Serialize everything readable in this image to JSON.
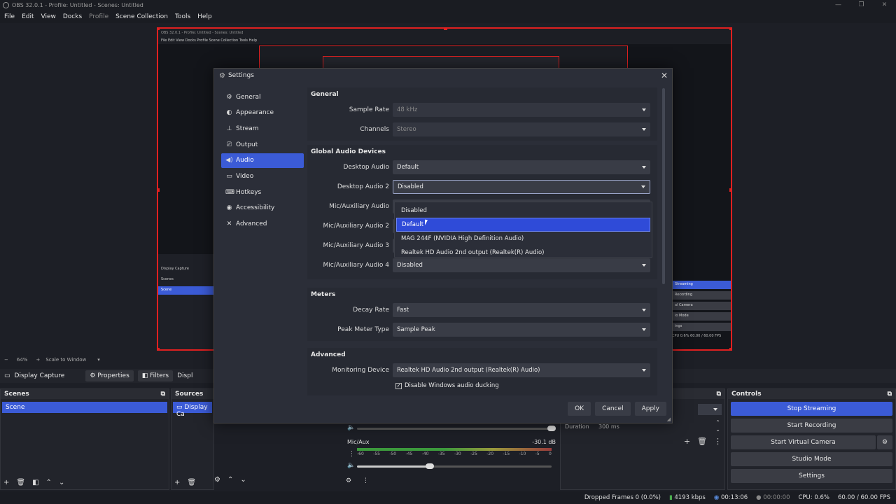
{
  "window": {
    "title": "OBS 32.0.1 - Profile: Untitled - Scenes: Untitled",
    "controls": [
      "—",
      "❐",
      "✕"
    ]
  },
  "menu": [
    "File",
    "Edit",
    "View",
    "Docks",
    "Profile",
    "Scene Collection",
    "Tools",
    "Help"
  ],
  "preview": {
    "mini_title": "OBS 32.0.1 - Profile: Untitled - Scenes: Untitled",
    "mini_menu": "File  Edit  View  Docks  Profile  Scene Collection  Tools  Help",
    "mini_capture": "Display Capture",
    "mini_scenes": "Scenes",
    "mini_scene": "Scene",
    "mini_buttons": [
      "Streaming",
      "Recording",
      "al Camera",
      "io Mode",
      "ings"
    ],
    "mini_stats": "CPU 0.6%   60.00 / 60.00 FPS"
  },
  "zoom": {
    "minus": "−",
    "level": "64%",
    "plus": "+",
    "label": "Scale to Window"
  },
  "source_toolbar": {
    "capture": "Display Capture",
    "properties": "Properties",
    "filters": "Filters",
    "display": "Displ"
  },
  "scenes": {
    "title": "Scenes",
    "selected": "Scene"
  },
  "sources": {
    "title": "Sources",
    "selected": "Display Ca"
  },
  "controls": {
    "title": "Controls",
    "buttons": [
      "Stop Streaming",
      "Start Recording",
      "Start Virtual Camera",
      "Studio Mode",
      "Settings"
    ]
  },
  "transition": {
    "duration_label": "Duration",
    "duration_value": "300 ms"
  },
  "mixer": {
    "name": "Mic/Aux",
    "db": "-30.1 dB",
    "ticks": [
      "-60",
      "-55",
      "-50",
      "-45",
      "-40",
      "-35",
      "-30",
      "-25",
      "-20",
      "-15",
      "-10",
      "-5",
      "0"
    ]
  },
  "status": {
    "dropped": "Dropped Frames 0 (0.0%)",
    "bitrate": "4193 kbps",
    "stream_time": "00:13:06",
    "rec_time": "00:00:00",
    "cpu": "CPU: 0.6%",
    "fps": "60.00 / 60.00 FPS"
  },
  "settings": {
    "title": "Settings",
    "nav": [
      "General",
      "Appearance",
      "Stream",
      "Output",
      "Audio",
      "Video",
      "Hotkeys",
      "Accessibility",
      "Advanced"
    ],
    "active_nav": "Audio",
    "general": {
      "title": "General",
      "sample_rate_label": "Sample Rate",
      "sample_rate": "48 kHz",
      "channels_label": "Channels",
      "channels": "Stereo"
    },
    "devices": {
      "title": "Global Audio Devices",
      "rows": [
        {
          "label": "Desktop Audio",
          "value": "Default"
        },
        {
          "label": "Desktop Audio 2",
          "value": "Disabled"
        },
        {
          "label": "Mic/Auxiliary Audio",
          "value": ""
        },
        {
          "label": "Mic/Auxiliary Audio 2",
          "value": ""
        },
        {
          "label": "Mic/Auxiliary Audio 3",
          "value": ""
        },
        {
          "label": "Mic/Auxiliary Audio 4",
          "value": "Disabled"
        }
      ],
      "popup": [
        "Disabled",
        "Default",
        "MAG 244F (NVIDIA High Definition Audio)",
        "Realtek HD Audio 2nd output (Realtek(R) Audio)"
      ],
      "popup_highlight": "Default"
    },
    "meters": {
      "title": "Meters",
      "decay_label": "Decay Rate",
      "decay": "Fast",
      "peak_label": "Peak Meter Type",
      "peak": "Sample Peak"
    },
    "advanced": {
      "title": "Advanced",
      "monitor_label": "Monitoring Device",
      "monitor": "Realtek HD Audio 2nd output (Realtek(R) Audio)",
      "ducking": "Disable Windows audio ducking"
    },
    "buttons": {
      "ok": "OK",
      "cancel": "Cancel",
      "apply": "Apply"
    }
  }
}
